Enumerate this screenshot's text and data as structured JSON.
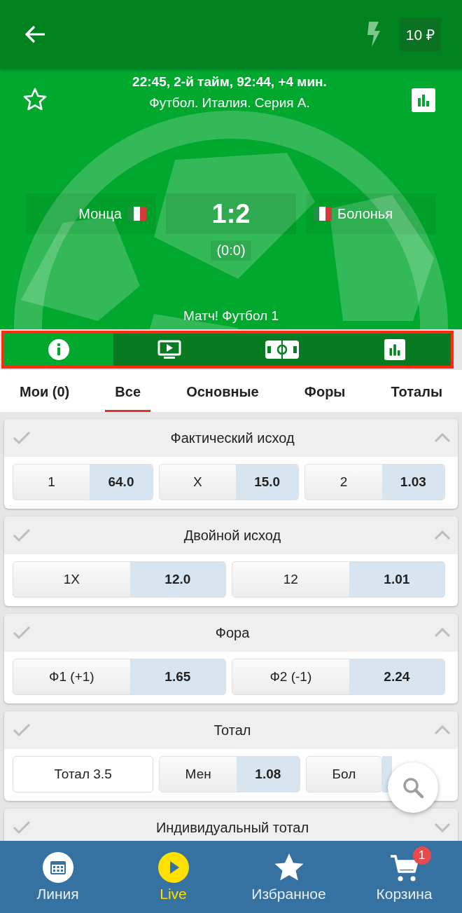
{
  "header": {
    "balance": "10 ₽"
  },
  "match": {
    "status": "22:45, 2-й тайм, 92:44, +4 мин.",
    "league": "Футбол. Италия. Серия А.",
    "home": "Монца",
    "away": "Болонья",
    "score": "1:2",
    "half_score": "(0:0)",
    "channel": "Матч! Футбол 1",
    "favorite": false
  },
  "view_tabs": [
    {
      "kind": "info",
      "selected": true
    },
    {
      "kind": "video",
      "selected": false
    },
    {
      "kind": "field",
      "selected": false
    },
    {
      "kind": "stats",
      "selected": false
    }
  ],
  "market_tabs": [
    {
      "label": "Мои (0)",
      "selected": false
    },
    {
      "label": "Все",
      "selected": true
    },
    {
      "label": "Основные",
      "selected": false
    },
    {
      "label": "Форы",
      "selected": false
    },
    {
      "label": "Тоталы",
      "selected": false
    }
  ],
  "markets": [
    {
      "title": "Фактический исход",
      "expanded": true,
      "outcomes": [
        {
          "kind": "bet",
          "label": "1",
          "odds": "64.0"
        },
        {
          "kind": "bet",
          "label": "X",
          "odds": "15.0"
        },
        {
          "kind": "bet",
          "label": "2",
          "odds": "1.03"
        }
      ]
    },
    {
      "title": "Двойной исход",
      "expanded": true,
      "outcomes": [
        {
          "kind": "bet",
          "label": "1X",
          "odds": "12.0"
        },
        {
          "kind": "bet",
          "label": "12",
          "odds": "1.01"
        }
      ]
    },
    {
      "title": "Фора",
      "expanded": true,
      "outcomes": [
        {
          "kind": "bet",
          "label": "Ф1 (+1)",
          "odds": "1.65"
        },
        {
          "kind": "bet",
          "label": "Ф2 (-1)",
          "odds": "2.24"
        }
      ]
    },
    {
      "title": "Тотал",
      "expanded": true,
      "outcomes": [
        {
          "kind": "label",
          "label": "Тотал 3.5"
        },
        {
          "kind": "bet",
          "label": "Мен",
          "odds": "1.08"
        },
        {
          "kind": "bet",
          "label": "Бол"
        }
      ]
    },
    {
      "title": "Индивидуальный тотал",
      "expanded": false
    }
  ],
  "bottom_nav": [
    {
      "kind": "calendar",
      "label": "Линия",
      "selected": false
    },
    {
      "kind": "live",
      "label": "Live",
      "selected": true
    },
    {
      "kind": "star",
      "label": "Избранное",
      "selected": false
    },
    {
      "kind": "cart",
      "label": "Корзина",
      "selected": false,
      "badge": "1"
    }
  ]
}
